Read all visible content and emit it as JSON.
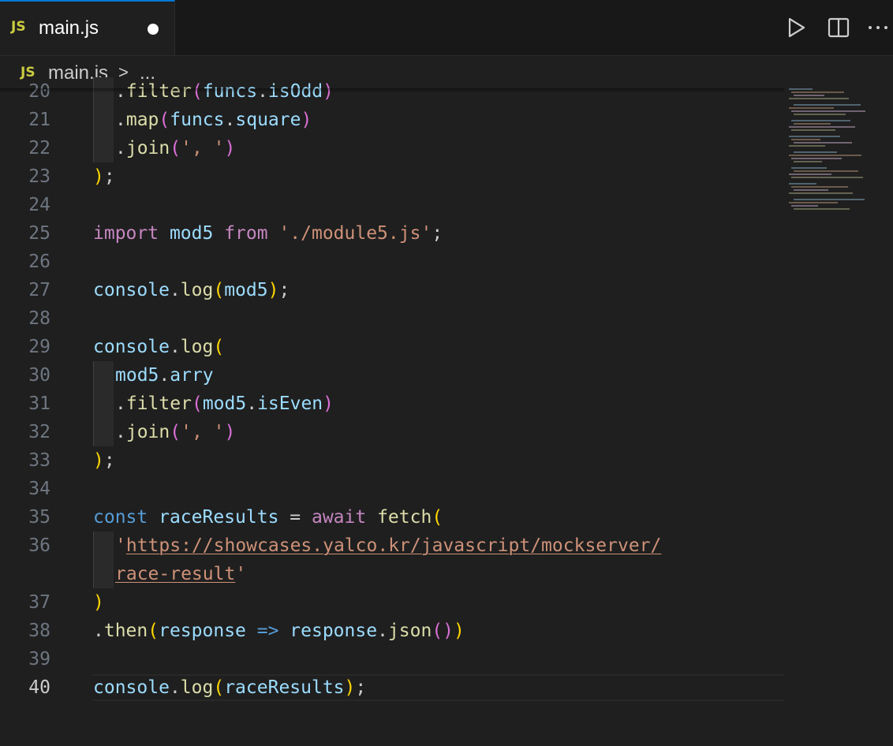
{
  "tab": {
    "badge": "JS",
    "label": "main.js"
  },
  "breadcrumb": {
    "badge": "JS",
    "file": "main.js",
    "separator": ">",
    "more": "..."
  },
  "toolbar": {
    "run_icon": "play-icon",
    "split_icon": "split-editor-icon",
    "more_icon": "more-actions-icon"
  },
  "colors": {
    "accent": "#0078d4",
    "keyword": "#c586c0",
    "declaration": "#569cd6",
    "variable": "#9cdcfe",
    "function": "#dcdcaa",
    "string": "#ce9178",
    "bracket1": "#ffd700",
    "bracket2": "#da70d6",
    "bracket3": "#179fff"
  },
  "editor": {
    "active_line": "40",
    "lines": [
      {
        "n": "20",
        "tokens": [
          {
            "t": ".",
            "c": "punc"
          },
          {
            "t": "filter",
            "c": "fn"
          },
          {
            "t": "(",
            "c": "p2"
          },
          {
            "t": "funcs",
            "c": "var"
          },
          {
            "t": ".",
            "c": "punc"
          },
          {
            "t": "isOdd",
            "c": "var"
          },
          {
            "t": ")",
            "c": "p2"
          }
        ],
        "indent": 1
      },
      {
        "n": "21",
        "tokens": [
          {
            "t": ".",
            "c": "punc"
          },
          {
            "t": "map",
            "c": "fn"
          },
          {
            "t": "(",
            "c": "p2"
          },
          {
            "t": "funcs",
            "c": "var"
          },
          {
            "t": ".",
            "c": "punc"
          },
          {
            "t": "square",
            "c": "var"
          },
          {
            "t": ")",
            "c": "p2"
          }
        ],
        "indent": 1
      },
      {
        "n": "22",
        "tokens": [
          {
            "t": ".",
            "c": "punc"
          },
          {
            "t": "join",
            "c": "fn"
          },
          {
            "t": "(",
            "c": "p2"
          },
          {
            "t": "', '",
            "c": "str"
          },
          {
            "t": ")",
            "c": "p2"
          }
        ],
        "indent": 1
      },
      {
        "n": "23",
        "tokens": [
          {
            "t": ")",
            "c": "p1"
          },
          {
            "t": ";",
            "c": "punc"
          }
        ],
        "indent": 0
      },
      {
        "n": "24",
        "tokens": [],
        "indent": 0
      },
      {
        "n": "25",
        "tokens": [
          {
            "t": "import ",
            "c": "kw"
          },
          {
            "t": "mod5 ",
            "c": "var"
          },
          {
            "t": "from ",
            "c": "kw"
          },
          {
            "t": "'./module5.js'",
            "c": "str"
          },
          {
            "t": ";",
            "c": "punc"
          }
        ],
        "indent": 0
      },
      {
        "n": "26",
        "tokens": [],
        "indent": 0
      },
      {
        "n": "27",
        "tokens": [
          {
            "t": "console",
            "c": "var"
          },
          {
            "t": ".",
            "c": "punc"
          },
          {
            "t": "log",
            "c": "fn"
          },
          {
            "t": "(",
            "c": "p1"
          },
          {
            "t": "mod5",
            "c": "var"
          },
          {
            "t": ")",
            "c": "p1"
          },
          {
            "t": ";",
            "c": "punc"
          }
        ],
        "indent": 0
      },
      {
        "n": "28",
        "tokens": [],
        "indent": 0
      },
      {
        "n": "29",
        "tokens": [
          {
            "t": "console",
            "c": "var"
          },
          {
            "t": ".",
            "c": "punc"
          },
          {
            "t": "log",
            "c": "fn"
          },
          {
            "t": "(",
            "c": "p1"
          }
        ],
        "indent": 0
      },
      {
        "n": "30",
        "tokens": [
          {
            "t": "mod5",
            "c": "var"
          },
          {
            "t": ".",
            "c": "punc"
          },
          {
            "t": "arry",
            "c": "var"
          }
        ],
        "indent": 1
      },
      {
        "n": "31",
        "tokens": [
          {
            "t": ".",
            "c": "punc"
          },
          {
            "t": "filter",
            "c": "fn"
          },
          {
            "t": "(",
            "c": "p2"
          },
          {
            "t": "mod5",
            "c": "var"
          },
          {
            "t": ".",
            "c": "punc"
          },
          {
            "t": "isEven",
            "c": "var"
          },
          {
            "t": ")",
            "c": "p2"
          }
        ],
        "indent": 1
      },
      {
        "n": "32",
        "tokens": [
          {
            "t": ".",
            "c": "punc"
          },
          {
            "t": "join",
            "c": "fn"
          },
          {
            "t": "(",
            "c": "p2"
          },
          {
            "t": "', '",
            "c": "str"
          },
          {
            "t": ")",
            "c": "p2"
          }
        ],
        "indent": 1
      },
      {
        "n": "33",
        "tokens": [
          {
            "t": ")",
            "c": "p1"
          },
          {
            "t": ";",
            "c": "punc"
          }
        ],
        "indent": 0
      },
      {
        "n": "34",
        "tokens": [],
        "indent": 0
      },
      {
        "n": "35",
        "tokens": [
          {
            "t": "const ",
            "c": "decl"
          },
          {
            "t": "raceResults ",
            "c": "var"
          },
          {
            "t": "= ",
            "c": "punc"
          },
          {
            "t": "await ",
            "c": "kw"
          },
          {
            "t": "fetch",
            "c": "fn"
          },
          {
            "t": "(",
            "c": "p1"
          }
        ],
        "indent": 0
      },
      {
        "n": "36",
        "tokens": [
          {
            "t": "'",
            "c": "str"
          },
          {
            "t": "https://showcases.yalco.kr/javascript/mockserver/",
            "c": "link"
          }
        ],
        "indent": 1
      },
      {
        "n": "",
        "tokens": [
          {
            "t": "race-result",
            "c": "link"
          },
          {
            "t": "'",
            "c": "str"
          }
        ],
        "indent": 1,
        "wrap": true
      },
      {
        "n": "37",
        "tokens": [
          {
            "t": ")",
            "c": "p1"
          }
        ],
        "indent": 0
      },
      {
        "n": "38",
        "tokens": [
          {
            "t": ".",
            "c": "punc"
          },
          {
            "t": "then",
            "c": "fn"
          },
          {
            "t": "(",
            "c": "p1"
          },
          {
            "t": "response ",
            "c": "var"
          },
          {
            "t": "=> ",
            "c": "decl"
          },
          {
            "t": "response",
            "c": "var"
          },
          {
            "t": ".",
            "c": "punc"
          },
          {
            "t": "json",
            "c": "fn"
          },
          {
            "t": "(",
            "c": "p2"
          },
          {
            "t": ")",
            "c": "p2"
          },
          {
            "t": ")",
            "c": "p1"
          }
        ],
        "indent": 0
      },
      {
        "n": "39",
        "tokens": [],
        "indent": 0
      },
      {
        "n": "40",
        "tokens": [
          {
            "t": "console",
            "c": "var"
          },
          {
            "t": ".",
            "c": "punc"
          },
          {
            "t": "log",
            "c": "fn"
          },
          {
            "t": "(",
            "c": "p1"
          },
          {
            "t": "raceResults",
            "c": "var"
          },
          {
            "t": ")",
            "c": "p1"
          },
          {
            "t": ";",
            "c": "punc"
          }
        ],
        "indent": 0
      }
    ]
  }
}
